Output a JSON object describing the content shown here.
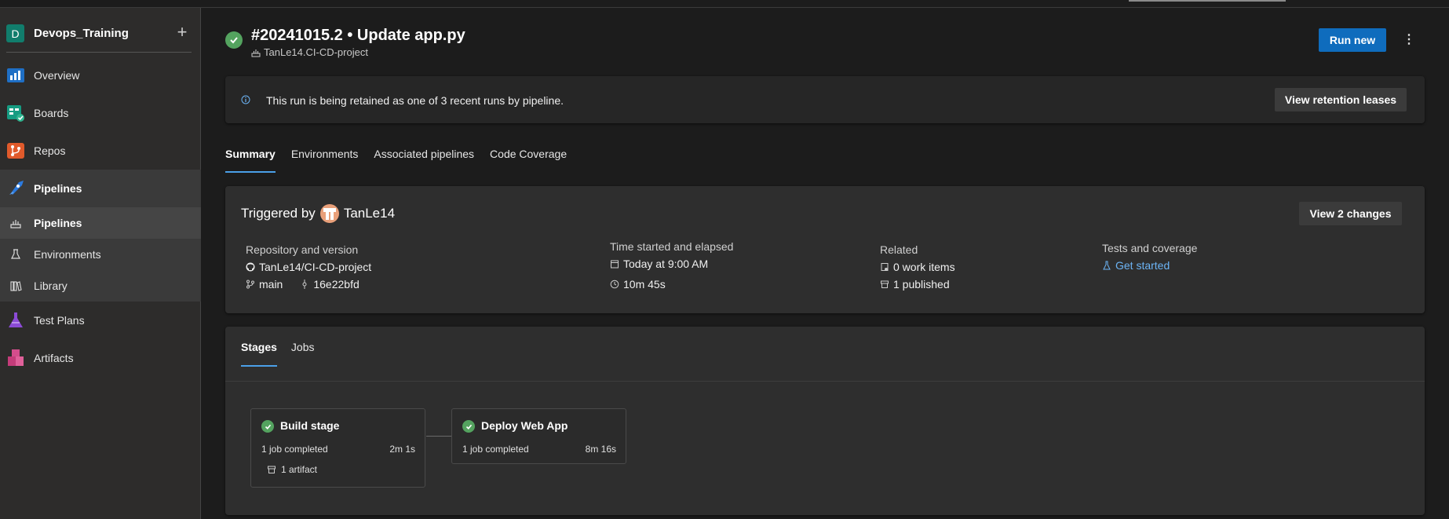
{
  "project": {
    "initial": "D",
    "name": "Devops_Training",
    "add_glyph": "+"
  },
  "sidebar": {
    "items": [
      {
        "label": "Overview",
        "icon": "overview-icon"
      },
      {
        "label": "Boards",
        "icon": "boards-icon"
      },
      {
        "label": "Repos",
        "icon": "repos-icon"
      },
      {
        "label": "Pipelines",
        "icon": "pipelines-icon"
      },
      {
        "label": "Test Plans",
        "icon": "test-plans-icon"
      },
      {
        "label": "Artifacts",
        "icon": "artifacts-icon"
      }
    ],
    "subitems": [
      {
        "label": "Pipelines",
        "icon": "pipeline-sub-icon"
      },
      {
        "label": "Environments",
        "icon": "environments-icon"
      },
      {
        "label": "Library",
        "icon": "library-icon"
      }
    ]
  },
  "run": {
    "title": "#20241015.2 • Update app.py",
    "pipeline_name": "TanLe14.CI-CD-project",
    "run_new_label": "Run new",
    "more_glyph": "⋮"
  },
  "banner": {
    "text": "This run is being retained as one of 3 recent runs by pipeline.",
    "button_label": "View retention leases"
  },
  "tabs": [
    "Summary",
    "Environments",
    "Associated pipelines",
    "Code Coverage"
  ],
  "summary": {
    "triggered_by_label": "Triggered by",
    "user": "TanLe14",
    "view_changes_label": "View 2 changes",
    "repo_header": "Repository and version",
    "repo": "TanLe14/CI-CD-project",
    "branch": "main",
    "commit": "16e22bfd",
    "time_header": "Time started and elapsed",
    "started": "Today at 9:00 AM",
    "elapsed": "10m 45s",
    "related_header": "Related",
    "work_items": "0 work items",
    "published": "1 published",
    "tests_header": "Tests and coverage",
    "tests_link": "Get started"
  },
  "stages_section": {
    "tabs": [
      "Stages",
      "Jobs"
    ],
    "stages": [
      {
        "name": "Build stage",
        "jobs": "1 job completed",
        "time": "2m 1s",
        "artifact": "1 artifact"
      },
      {
        "name": "Deploy Web App",
        "jobs": "1 job completed",
        "time": "8m 16s"
      }
    ]
  },
  "colors": {
    "accent": "#0f6cbd",
    "success": "#54a35f",
    "link": "#6cb4f5"
  }
}
